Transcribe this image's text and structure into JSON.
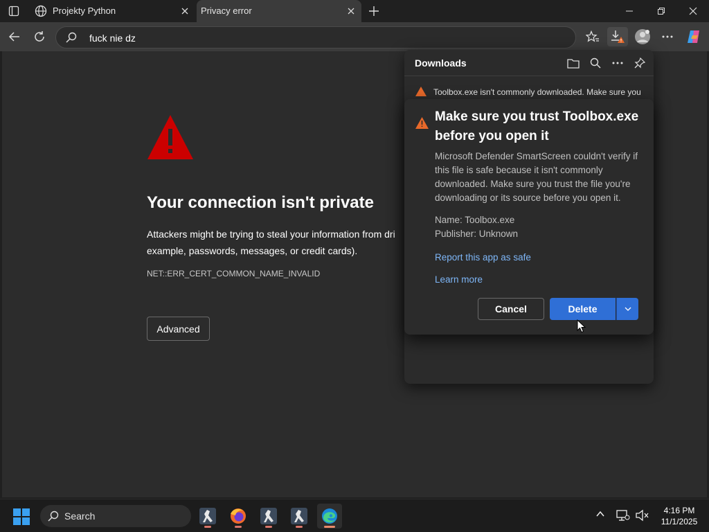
{
  "tabs": [
    {
      "title": "Projekty Python",
      "favicon": "globe-icon"
    },
    {
      "title": "Privacy error",
      "active": true
    }
  ],
  "address": {
    "text": "fuck nie dz"
  },
  "page": {
    "heading": "Your connection isn't private",
    "description_line1": "Attackers might be trying to steal your information from dri",
    "description_line2": "example, passwords, messages, or credit cards).",
    "error_code": "NET::ERR_CERT_COMMON_NAME_INVALID",
    "advanced_label": "Advanced"
  },
  "downloads": {
    "title": "Downloads",
    "item_text": "Toolbox.exe isn't commonly downloaded. Make sure you"
  },
  "dialog": {
    "title": "Make sure you trust Toolbox.exe before you open it",
    "body": "Microsoft Defender SmartScreen couldn't verify if this file is safe because it isn't commonly downloaded. Make sure you trust the file you're downloading or its source before you open it.",
    "name": "Name: Toolbox.exe",
    "publisher": "Publisher: Unknown",
    "report_link": "Report this app as safe",
    "learn_link": "Learn more",
    "cancel_label": "Cancel",
    "delete_label": "Delete"
  },
  "taskbar": {
    "search_label": "Search",
    "apps": [
      "counter-strike-icon",
      "firefox-icon",
      "counter-strike-icon",
      "counter-strike-icon",
      "edge-icon"
    ],
    "time": "4:16 PM",
    "date": "11/1/2025"
  },
  "colors": {
    "warning_red": "#cc0000",
    "warning_orange": "#e8692a",
    "accent_blue": "#2f6fd6",
    "link_blue": "#7eb6f7"
  }
}
